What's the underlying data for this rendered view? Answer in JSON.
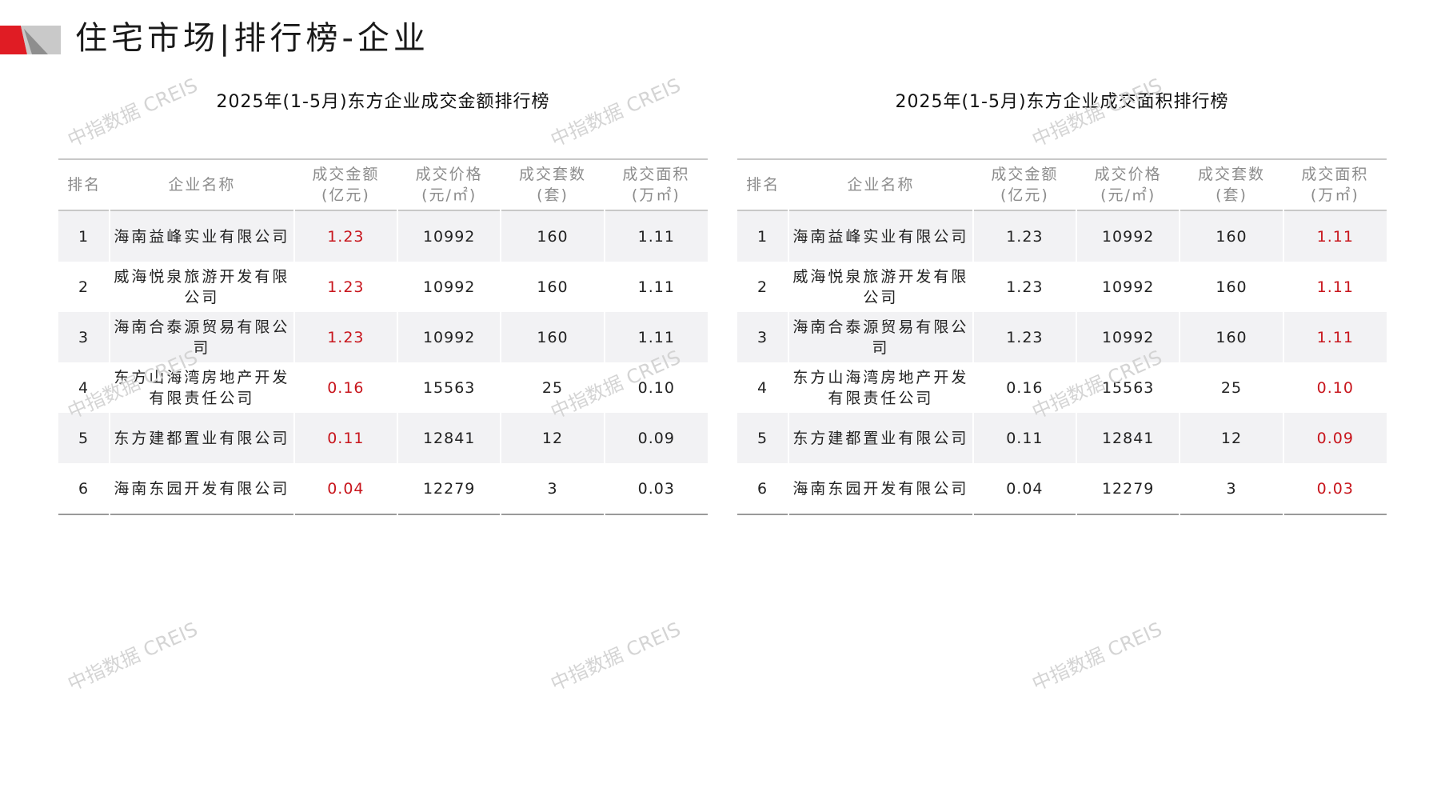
{
  "page_title": "住宅市场|排行榜-企业",
  "watermark": "中指数据 CREIS",
  "colors": {
    "accent_red": "#c8161d",
    "logo_red": "#e01c24",
    "logo_gray": "#9a9a9a"
  },
  "left_table": {
    "title": "2025年(1-5月)东方企业成交金额排行榜",
    "headers": [
      "排名",
      "企业名称",
      "成交金额\n(亿元)",
      "成交价格\n(元/㎡)",
      "成交套数\n(套)",
      "成交面积\n(万㎡)"
    ],
    "rows": [
      [
        "1",
        "海南益峰实业有限公司",
        "1.23",
        "10992",
        "160",
        "1.11"
      ],
      [
        "2",
        "威海悦泉旅游开发有限公司",
        "1.23",
        "10992",
        "160",
        "1.11"
      ],
      [
        "3",
        "海南合泰源贸易有限公司",
        "1.23",
        "10992",
        "160",
        "1.11"
      ],
      [
        "4",
        "东方山海湾房地产开发有限责任公司",
        "0.16",
        "15563",
        "25",
        "0.10"
      ],
      [
        "5",
        "东方建都置业有限公司",
        "0.11",
        "12841",
        "12",
        "0.09"
      ],
      [
        "6",
        "海南东园开发有限公司",
        "0.04",
        "12279",
        "3",
        "0.03"
      ]
    ]
  },
  "right_table": {
    "title": "2025年(1-5月)东方企业成交面积排行榜",
    "headers": [
      "排名",
      "企业名称",
      "成交金额\n(亿元)",
      "成交价格\n(元/㎡)",
      "成交套数\n(套)",
      "成交面积\n(万㎡)"
    ],
    "rows": [
      [
        "1",
        "海南益峰实业有限公司",
        "1.23",
        "10992",
        "160",
        "1.11"
      ],
      [
        "2",
        "威海悦泉旅游开发有限公司",
        "1.23",
        "10992",
        "160",
        "1.11"
      ],
      [
        "3",
        "海南合泰源贸易有限公司",
        "1.23",
        "10992",
        "160",
        "1.11"
      ],
      [
        "4",
        "东方山海湾房地产开发有限责任公司",
        "0.16",
        "15563",
        "25",
        "0.10"
      ],
      [
        "5",
        "东方建都置业有限公司",
        "0.11",
        "12841",
        "12",
        "0.09"
      ],
      [
        "6",
        "海南东园开发有限公司",
        "0.04",
        "12279",
        "3",
        "0.03"
      ]
    ]
  }
}
